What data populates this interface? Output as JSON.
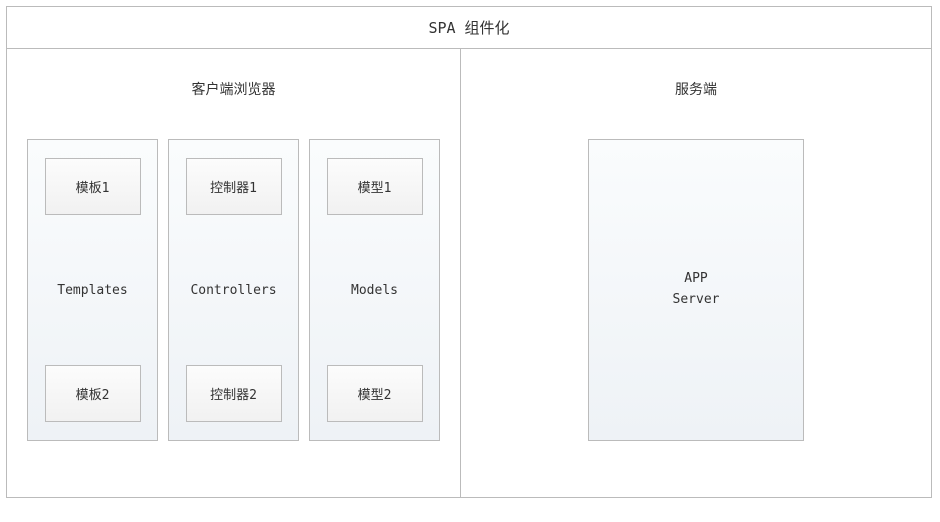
{
  "title": "SPA 组件化",
  "client": {
    "title": "客户端浏览器",
    "columns": [
      {
        "top": "模板1",
        "label": "Templates",
        "bottom": "模板2"
      },
      {
        "top": "控制器1",
        "label": "Controllers",
        "bottom": "控制器2"
      },
      {
        "top": "模型1",
        "label": "Models",
        "bottom": "模型2"
      }
    ]
  },
  "server": {
    "title": "服务端",
    "box_line1": "APP",
    "box_line2": "Server"
  }
}
